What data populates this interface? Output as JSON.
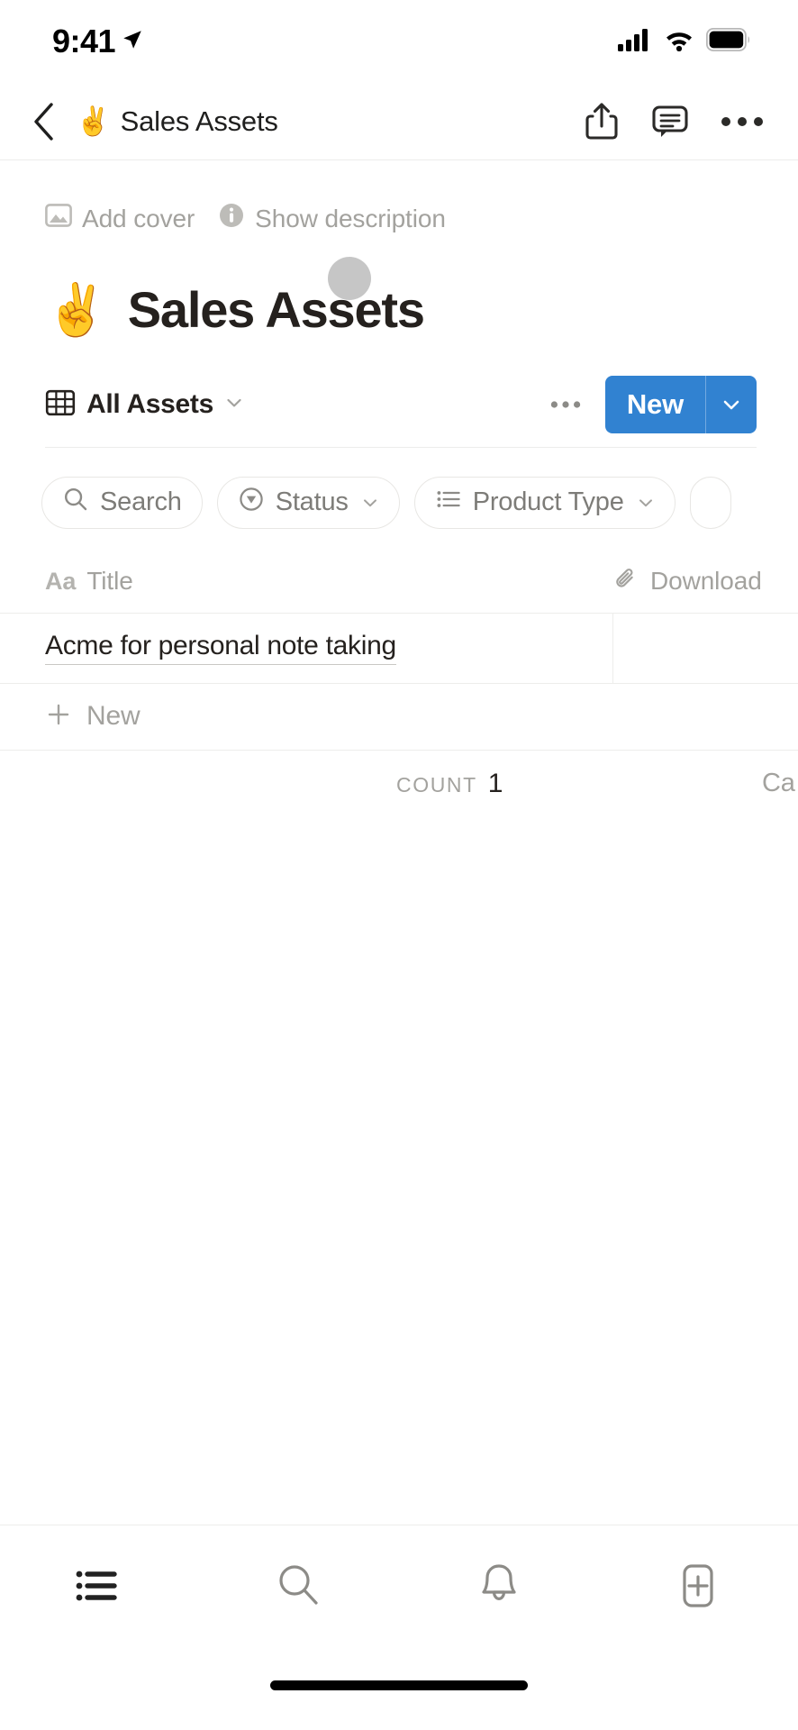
{
  "status_bar": {
    "time": "9:41",
    "location_icon": "location-arrow-icon",
    "cellular_icon": "cellular-signal-icon",
    "wifi_icon": "wifi-icon",
    "battery_icon": "battery-full-icon"
  },
  "nav": {
    "back_icon": "chevron-left-icon",
    "emoji": "✌️",
    "title": "Sales Assets",
    "share_icon": "share-icon",
    "comment_icon": "comment-icon",
    "more_icon": "more-horizontal-icon"
  },
  "page_meta": {
    "add_cover": "Add cover",
    "add_cover_icon": "image-icon",
    "show_description": "Show description",
    "show_description_icon": "info-icon"
  },
  "page_title": {
    "emoji": "✌️",
    "text": "Sales Assets"
  },
  "view_bar": {
    "view_icon": "table-view-icon",
    "view_name": "All Assets",
    "view_caret_icon": "chevron-down-icon",
    "more_icon": "more-horizontal-icon",
    "new_label": "New",
    "new_caret_icon": "chevron-down-icon",
    "accent_color": "#3182D1"
  },
  "filters": [
    {
      "label": "Search",
      "icon": "search-icon",
      "has_caret": false
    },
    {
      "label": "Status",
      "icon": "status-select-icon",
      "has_caret": true
    },
    {
      "label": "Product Type",
      "icon": "multi-select-icon",
      "has_caret": true
    }
  ],
  "table": {
    "columns": [
      {
        "label": "Title",
        "icon": "title-text-icon",
        "icon_glyph": "Aa"
      },
      {
        "label": "Download",
        "icon": "paperclip-icon"
      }
    ],
    "rows": [
      {
        "title": "Acme for personal note taking",
        "download": ""
      }
    ],
    "new_row_label": "New",
    "new_row_icon": "plus-icon",
    "footer": {
      "count_label": "COUNT",
      "count_value": "1",
      "right_partial": "Ca"
    }
  },
  "tab_bar": [
    {
      "name": "list",
      "icon": "list-icon",
      "active": true
    },
    {
      "name": "search",
      "icon": "search-icon",
      "active": false
    },
    {
      "name": "notifications",
      "icon": "bell-icon",
      "active": false
    },
    {
      "name": "new-page",
      "icon": "add-page-icon",
      "active": false
    }
  ]
}
